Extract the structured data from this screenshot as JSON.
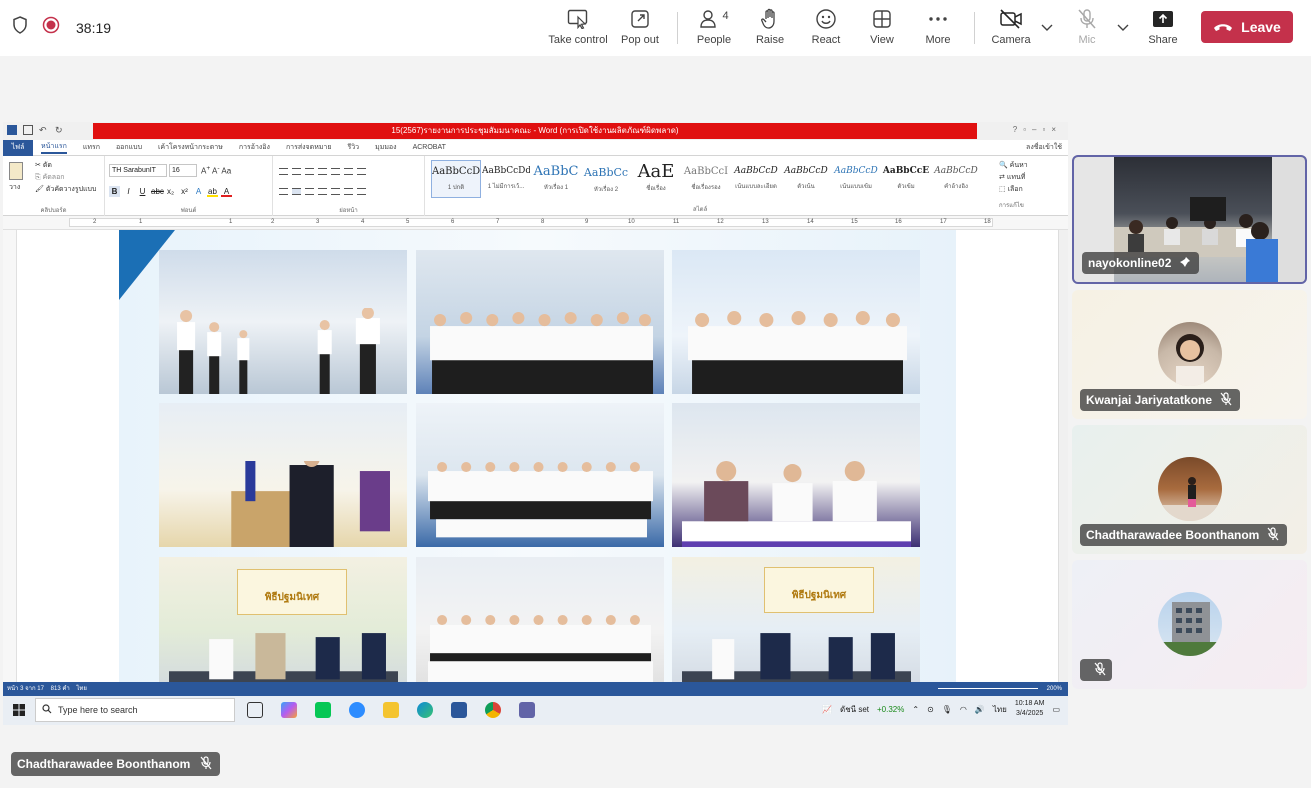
{
  "meeting": {
    "timer": "38:19",
    "toolbar": {
      "take_control": "Take control",
      "pop_out": "Pop out",
      "people": "People",
      "people_count": "4",
      "raise": "Raise",
      "react": "React",
      "view": "View",
      "more": "More",
      "camera": "Camera",
      "mic": "Mic",
      "share": "Share",
      "leave": "Leave"
    },
    "colors": {
      "leave": "#c4314b",
      "accent": "#6264a7",
      "word_blue": "#2b579a"
    }
  },
  "word": {
    "title": "15(2567)รายงานการประชุมสัมมนาคณะ - Word (การเปิดใช้งานผลิตภัณฑ์ผิดพลาด)",
    "file_tab": "ไฟล์",
    "tabs": [
      "หน้าแรก",
      "แทรก",
      "ออกแบบ",
      "เค้าโครงหน้ากระดาษ",
      "การอ้างอิง",
      "การส่งจดหมาย",
      "รีวิว",
      "มุมมอง",
      "ACROBAT"
    ],
    "user": "ลงชื่อเข้าใช้",
    "font_name": "TH SarabunIT",
    "font_size": "16",
    "clipboard": {
      "cut": "ตัด",
      "copy": "คัดลอก",
      "format_painter": "ตัวคัดวางรูปแบบ",
      "paste": "วาง"
    },
    "group_labels": [
      "คลิปบอร์ด",
      "ฟอนต์",
      "ย่อหน้า",
      "สไตล์",
      "การแก้ไข"
    ],
    "styles": [
      {
        "sample": "AaBbCcD",
        "name": "1 ปกติ"
      },
      {
        "sample": "AaBbCcDd",
        "name": "1 ไม่มีการเว้..."
      },
      {
        "sample": "AaBbC",
        "name": "หัวเรื่อง 1"
      },
      {
        "sample": "AaBbCc",
        "name": "หัวเรื่อง 2"
      },
      {
        "sample": "AaE",
        "name": "ชื่อเรื่อง"
      },
      {
        "sample": "AaBbCcI",
        "name": "ชื่อเรื่องรอง"
      },
      {
        "sample": "AaBbCcD",
        "name": "เน้นแบบละเอียด"
      },
      {
        "sample": "AaBbCcD",
        "name": "ตัวเน้น"
      },
      {
        "sample": "AaBbCcD",
        "name": "เน้นแบบเข้ม"
      },
      {
        "sample": "AaBbCcE",
        "name": "ตัวเข้ม"
      },
      {
        "sample": "AaBbCcD",
        "name": "คำอ้างอิง"
      }
    ],
    "editing": {
      "find": "ค้นหา",
      "replace": "แทนที่",
      "select": "เลือก"
    },
    "ruler_numbers": [
      "2",
      "1",
      "1",
      "2",
      "3",
      "4",
      "5",
      "6",
      "7",
      "8",
      "9",
      "10",
      "11",
      "12",
      "13",
      "14",
      "15",
      "16",
      "17",
      "18"
    ],
    "status": {
      "page": "หน้า 3 จาก 17",
      "words": "813 คำ",
      "language": "ไทย",
      "zoom": "200%"
    }
  },
  "taskbar": {
    "search_placeholder": "Type here to search",
    "stock_name": "ดัชนี set",
    "stock_change": "+0.32%",
    "input_lang": "ไทย",
    "time": "10:18 AM",
    "date": "3/4/2025"
  },
  "participants": [
    {
      "name": "nayokonline02",
      "pinned": true,
      "muted": false
    },
    {
      "name": "Kwanjai Jariyatatkone",
      "pinned": false,
      "muted": true
    },
    {
      "name": "Chadtharawadee Boonthanom",
      "pinned": false,
      "muted": true
    },
    {
      "name": "",
      "pinned": false,
      "muted": true
    }
  ],
  "presenter": {
    "name": "Chadtharawadee Boonthanom"
  },
  "photo_banner": {
    "text": "พิธีปฐมนิเทศ"
  }
}
